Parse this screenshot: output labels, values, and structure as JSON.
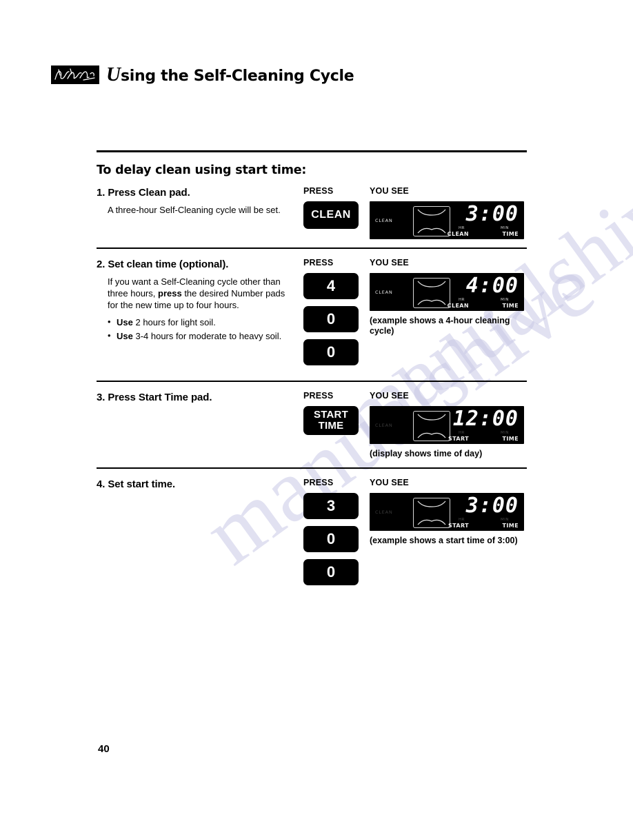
{
  "header": {
    "logo_icon": "brand-signature-logo",
    "dropcap": "U",
    "title_rest": "sing the Self-Cleaning Cycle"
  },
  "section": {
    "heading": "To delay clean using start time:"
  },
  "columns": {
    "press_label": "PRESS",
    "you_see_label": "YOU SEE"
  },
  "steps": [
    {
      "title": "1. Press Clean pad.",
      "body_line1": "A three-hour Self-Cleaning cycle will",
      "body_line2": "be set.",
      "pads": [
        {
          "label": "CLEAN",
          "type": "text"
        }
      ],
      "display": {
        "clean_label": "CLEAN",
        "clean_lit": true,
        "digits": "3:00",
        "unit_hr": "HR",
        "unit_min": "MIN",
        "func_left": "CLEAN",
        "func_right": "TIME",
        "oven_icon": "oven-cavity-icon"
      },
      "caption": ""
    },
    {
      "title": "2. Set clean time (optional).",
      "body_prefix": "If you want a Self-Cleaning cycle other than three hours, ",
      "body_bold": "press",
      "body_suffix": " the desired Number pads for the new time up to four hours.",
      "bullets": [
        {
          "bold": "Use",
          "rest": " 2 hours for light soil."
        },
        {
          "bold": "Use",
          "rest": " 3-4 hours for moderate to heavy soil."
        }
      ],
      "pads": [
        {
          "label": "4",
          "type": "num"
        },
        {
          "label": "0",
          "type": "num"
        },
        {
          "label": "0",
          "type": "num"
        }
      ],
      "display": {
        "clean_label": "CLEAN",
        "clean_lit": true,
        "digits": "4:00",
        "unit_hr": "HR",
        "unit_min": "MIN",
        "func_left": "CLEAN",
        "func_right": "TIME",
        "oven_icon": "oven-cavity-icon"
      },
      "caption_line1": "(example shows a 4-hour",
      "caption_line2": "cleaning cycle)"
    },
    {
      "title": "3. Press Start Time pad.",
      "pads": [
        {
          "label_line1": "START",
          "label_line2": "TIME",
          "type": "start"
        }
      ],
      "display": {
        "clean_label": "CLEAN",
        "clean_lit": false,
        "digits": "12:00",
        "unit_hr": "HR",
        "unit_min": "MIN",
        "func_left": "START",
        "func_right": "TIME",
        "oven_icon": "oven-cavity-icon"
      },
      "caption": "(display shows time of day)"
    },
    {
      "title": "4. Set start time.",
      "pads": [
        {
          "label": "3",
          "type": "num"
        },
        {
          "label": "0",
          "type": "num"
        },
        {
          "label": "0",
          "type": "num"
        }
      ],
      "display": {
        "clean_label": "CLEAN",
        "clean_lit": false,
        "digits": "3:00",
        "unit_hr": "HR",
        "unit_min": "MIN",
        "func_left": "START",
        "func_right": "TIME",
        "oven_icon": "oven-cavity-icon"
      },
      "caption": "(example shows a start time of 3:00)"
    }
  ],
  "footer": {
    "page_number": "40"
  },
  "watermark": {
    "text_a": "manualshive",
    "text_b": "manualshive.com"
  },
  "colors": {
    "ink": "#000000",
    "paper": "#ffffff",
    "display_bg": "#000000",
    "display_text": "#ffffff",
    "watermark": "#c9c9e6"
  }
}
